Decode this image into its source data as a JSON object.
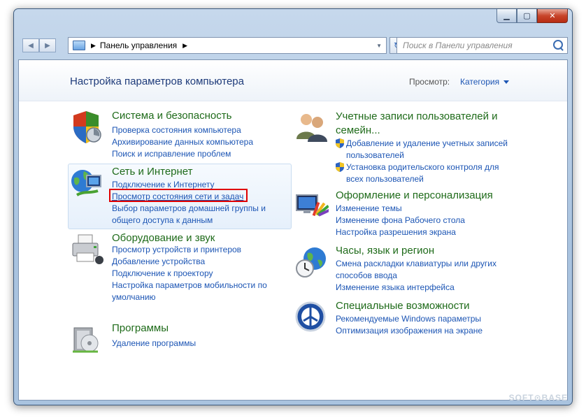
{
  "window": {
    "minimize": "▁",
    "maximize": "▢",
    "close": "✕"
  },
  "nav": {
    "back": "◀",
    "forward": "▶",
    "breadcrumb_sep": "▶",
    "address": "Панель управления",
    "address_tail": "▶",
    "dropdown": "▼",
    "refresh": "↻",
    "search_placeholder": "Поиск в Панели управления"
  },
  "header": {
    "title": "Настройка параметров компьютера",
    "view_label": "Просмотр:",
    "view_value": "Категория"
  },
  "categories": {
    "system": {
      "title": "Система и безопасность",
      "links": [
        "Проверка состояния компьютера",
        "Архивирование данных компьютера",
        "Поиск и исправление проблем"
      ]
    },
    "network": {
      "title": "Сеть и Интернет",
      "links": [
        "Подключение к Интернету",
        "Просмотр состояния сети и задач",
        "Выбор параметров домашней группы и общего доступа к данным"
      ]
    },
    "hardware": {
      "title": "Оборудование и звук",
      "links": [
        "Просмотр устройств и принтеров",
        "Добавление устройства",
        "Подключение к проектору",
        "Настройка параметров мобильности по умолчанию"
      ]
    },
    "programs": {
      "title": "Программы",
      "links": [
        "Удаление программы"
      ]
    },
    "accounts": {
      "title": "Учетные записи пользователей и семейн...",
      "links": [
        "Добавление и удаление учетных записей пользователей",
        "Установка родительского контроля для всех пользователей"
      ]
    },
    "appearance": {
      "title": "Оформление и персонализация",
      "links": [
        "Изменение темы",
        "Изменение фона Рабочего стола",
        "Настройка разрешения экрана"
      ]
    },
    "clock": {
      "title": "Часы, язык и регион",
      "links": [
        "Смена раскладки клавиатуры или других способов ввода",
        "Изменение языка интерфейса"
      ]
    },
    "access": {
      "title": "Специальные возможности",
      "links": [
        "Рекомендуемые Windows параметры",
        "Оптимизация изображения на экране"
      ]
    }
  },
  "watermark": "SOFT⊙BASE"
}
